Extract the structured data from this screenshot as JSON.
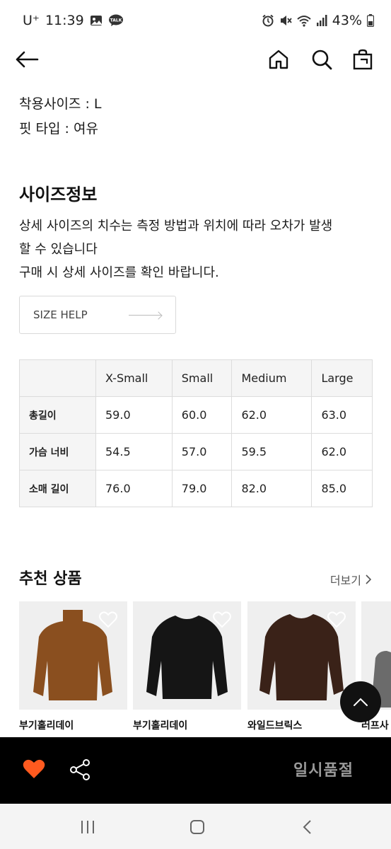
{
  "status_bar": {
    "carrier": "U⁺",
    "time": "11:39",
    "battery": "43%"
  },
  "product_info": {
    "wearing_size": "착용사이즈 : L",
    "fit_type": "핏 타입 : 여유"
  },
  "size_info": {
    "title": "사이즈정보",
    "description_line1": "상세 사이즈의 치수는 측정 방법과 위치에 따라 오차가 발생",
    "description_line2": "할 수 있습니다",
    "description_line3": "구매 시 상세 사이즈를 확인 바랍니다.",
    "size_help_label": "SIZE HELP"
  },
  "size_table": {
    "columns": [
      "X-Small",
      "Small",
      "Medium",
      "Large"
    ],
    "rows": [
      {
        "label": "총길이",
        "values": [
          "59.0",
          "60.0",
          "62.0",
          "63.0"
        ]
      },
      {
        "label": "가슴 너비",
        "values": [
          "54.5",
          "57.0",
          "59.5",
          "62.0"
        ]
      },
      {
        "label": "소매 길이",
        "values": [
          "76.0",
          "79.0",
          "82.0",
          "85.0"
        ]
      }
    ]
  },
  "recommended": {
    "title": "추천 상품",
    "more_label": "더보기",
    "items": [
      {
        "brand": "부기홀리데이",
        "color": "#8a4f1f"
      },
      {
        "brand": "부기홀리데이",
        "color": "#151515"
      },
      {
        "brand": "와일드브릭스",
        "color": "#3a2218"
      },
      {
        "brand": "러프사",
        "color": "#6b6b6b"
      }
    ]
  },
  "bottom_bar": {
    "soldout_label": "일시품절",
    "heart_color": "#ff5a1f"
  },
  "icons": [
    "back-arrow-icon",
    "home-icon",
    "search-icon",
    "bag-icon",
    "heart-icon",
    "share-icon",
    "chevron-up-icon",
    "chevron-right-icon"
  ]
}
